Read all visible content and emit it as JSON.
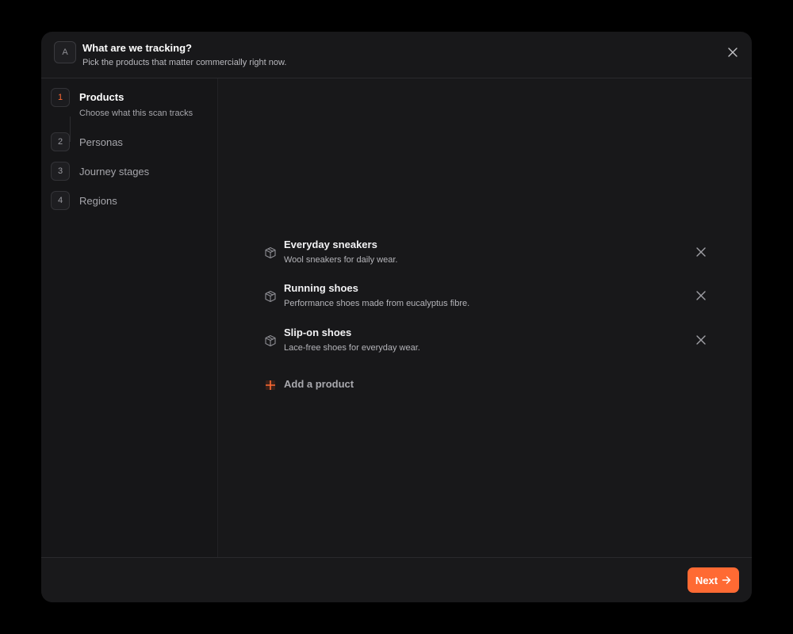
{
  "header": {
    "logo_letter": "A",
    "title": "What are we tracking?",
    "subtitle": "Pick the products that matter commercially right now."
  },
  "steps": [
    {
      "number": "1",
      "label": "Products",
      "description": "Choose what this scan tracks",
      "active": true
    },
    {
      "number": "2",
      "label": "Personas"
    },
    {
      "number": "3",
      "label": "Journey stages"
    },
    {
      "number": "4",
      "label": "Regions"
    }
  ],
  "products": [
    {
      "name": "Everyday sneakers",
      "description": "Wool sneakers for daily wear.",
      "icon": "box-icon"
    },
    {
      "name": "Running shoes",
      "description": "Performance shoes made from eucalyptus fibre.",
      "icon": "box-icon"
    },
    {
      "name": "Slip-on shoes",
      "description": "Lace-free shoes for everyday wear.",
      "icon": "box-icon"
    }
  ],
  "add_product_label": "Add a product",
  "footer": {
    "next_label": "Next"
  },
  "colors": {
    "accent": "#ff6a33",
    "background": "#18181a",
    "page": "#000000"
  }
}
